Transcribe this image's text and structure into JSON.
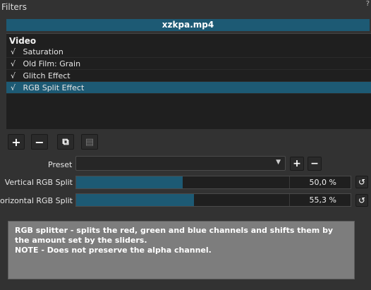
{
  "panel": {
    "title": "Filters",
    "corner_mark": "?"
  },
  "file": {
    "name": "xzkpa.mp4"
  },
  "filter_list": {
    "header": "Video",
    "items": [
      {
        "check": "√",
        "label": "Saturation"
      },
      {
        "check": "√",
        "label": "Old Film: Grain"
      },
      {
        "check": "√",
        "label": "Glitch Effect"
      },
      {
        "check": "√",
        "label": "RGB Split Effect",
        "selected": true
      }
    ]
  },
  "toolbar": {
    "buttons": [
      {
        "icon": "plus-icon",
        "glyph": "+"
      },
      {
        "icon": "minus-icon",
        "glyph": "−"
      },
      {
        "icon": "copy-icon",
        "glyph": "⧉"
      },
      {
        "icon": "paste-icon",
        "glyph": "▤"
      }
    ]
  },
  "preset": {
    "label": "Preset",
    "value": ""
  },
  "params": [
    {
      "label": "Vertical RGB Split",
      "value_text": "50,0 %",
      "fraction": 0.5
    },
    {
      "label": "Horizontal RGB Split",
      "value_text": "55,3 %",
      "fraction": 0.553
    }
  ],
  "description": {
    "line1": "RGB splitter - splits the red, green and blue channels and shifts them by the amount set by the sliders.",
    "line2": "NOTE - Does not preserve the alpha channel."
  },
  "colors": {
    "accent": "#1d5a74",
    "background": "#323232",
    "list_bg": "#1f1f1f",
    "description_bg": "#7d7d7d"
  }
}
